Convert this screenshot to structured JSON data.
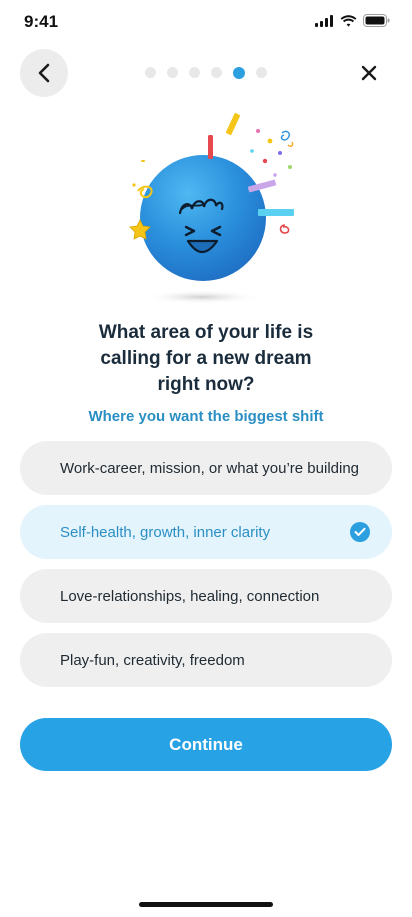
{
  "status_bar": {
    "time": "9:41",
    "icons": [
      "cellular-icon",
      "wifi-icon",
      "battery-icon"
    ]
  },
  "navigation": {
    "back_icon": "chevron-left-icon",
    "close_icon": "close-icon",
    "progress": {
      "total_steps": 6,
      "current_step": 5
    }
  },
  "illustration": {
    "description_icon": "celebrating-blue-ball-icon"
  },
  "question": {
    "line1": "What area of your life is",
    "line2": "calling for a new dream",
    "line3": "right now?"
  },
  "subtitle": "Where you want the biggest shift",
  "options": [
    {
      "label": "Work-career, mission, or what you’re building",
      "selected": false
    },
    {
      "label": "Self-health, growth, inner clarity",
      "selected": true
    },
    {
      "label": "Love-relationships, healing, connection",
      "selected": false
    },
    {
      "label": "Play-fun, creativity, freedom",
      "selected": false
    }
  ],
  "continue_label": "Continue",
  "colors": {
    "accent": "#27a2e5",
    "selected_bg": "#e3f4fd",
    "option_bg": "#efefef",
    "text_dark": "#1b2d3d",
    "subtitle": "#2b8fc4"
  }
}
